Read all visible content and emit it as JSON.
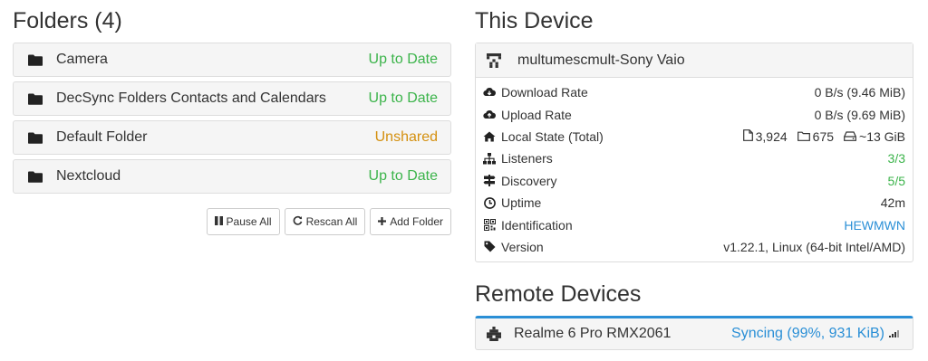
{
  "folders_section": {
    "title": "Folders (4)",
    "folders": [
      {
        "name": "Camera",
        "status": "Up to Date"
      },
      {
        "name": "DecSync Folders Contacts and Calendars",
        "status": "Up to Date"
      },
      {
        "name": "Default Folder",
        "status": "Unshared"
      },
      {
        "name": "Nextcloud",
        "status": "Up to Date"
      }
    ],
    "buttons": {
      "pause_all": "Pause All",
      "rescan_all": "Rescan All",
      "add_folder": "Add Folder"
    }
  },
  "this_device": {
    "title": "This Device",
    "device_name": "multumescmult-Sony Vaio",
    "rows": {
      "download_rate": {
        "label": "Download Rate",
        "value": "0 B/s (9.46 MiB)"
      },
      "upload_rate": {
        "label": "Upload Rate",
        "value": "0 B/s (9.69 MiB)"
      },
      "local_state": {
        "label": "Local State (Total)",
        "files": "3,924",
        "folders": "675",
        "size": "~13 GiB"
      },
      "listeners": {
        "label": "Listeners",
        "value": "3/3"
      },
      "discovery": {
        "label": "Discovery",
        "value": "5/5"
      },
      "uptime": {
        "label": "Uptime",
        "value": "42m"
      },
      "identification": {
        "label": "Identification",
        "value": "HEWMWN"
      },
      "version": {
        "label": "Version",
        "value": "v1.22.1, Linux (64-bit Intel/AMD)"
      }
    }
  },
  "remote_devices": {
    "title": "Remote Devices",
    "devices": [
      {
        "name": "Realme 6 Pro RMX2061",
        "status": "Syncing (99%, 931 KiB)"
      }
    ]
  },
  "colors": {
    "up_to_date": "#3cb44b",
    "unshared": "#d4900f",
    "link_blue": "#2a8fd6"
  }
}
